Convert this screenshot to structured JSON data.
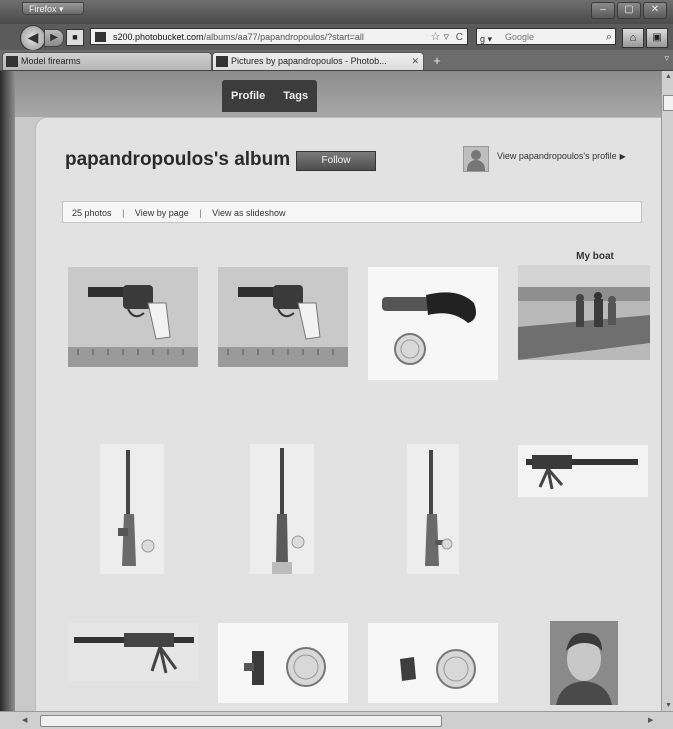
{
  "browser": {
    "app_menu_label": "Firefox",
    "window_controls": [
      "–",
      "▢",
      "✕"
    ],
    "url_host": "s200.photobucket.com",
    "url_path": "/albums/aa77/papandropoulos/?start=all",
    "search_placeholder": "Google",
    "tabs": [
      {
        "label": "Model firearms",
        "active": false
      },
      {
        "label": "Pictures by papandropoulos - Photob...",
        "active": true
      }
    ],
    "new_tab_label": "+"
  },
  "site_nav": {
    "items": [
      "Profile",
      "Tags"
    ]
  },
  "album": {
    "title": "papandropoulos's album",
    "follow_label": "Follow",
    "profile_link_label": "View papandropoulos's profile",
    "photo_count": "25 photos",
    "view_by_page": "View by page",
    "view_slideshow": "View as slideshow"
  },
  "photos": [
    {
      "caption": "",
      "subject": "revolver with ruler"
    },
    {
      "caption": "",
      "subject": "revolver with ruler"
    },
    {
      "caption": "",
      "subject": "pinfire pistol with coin"
    },
    {
      "caption": "My boat",
      "subject": "people on a boat"
    },
    {
      "caption": "",
      "subject": "miniature rifle with coin"
    },
    {
      "caption": "",
      "subject": "miniature rifle with coin"
    },
    {
      "caption": "",
      "subject": "miniature rifle with coin"
    },
    {
      "caption": "",
      "subject": "machine gun on tripod"
    },
    {
      "caption": "",
      "subject": "machine gun on tripod"
    },
    {
      "caption": "",
      "subject": "miniature part with coin"
    },
    {
      "caption": "",
      "subject": "miniature part with coin"
    },
    {
      "caption": "",
      "subject": "portrait of a man"
    }
  ]
}
